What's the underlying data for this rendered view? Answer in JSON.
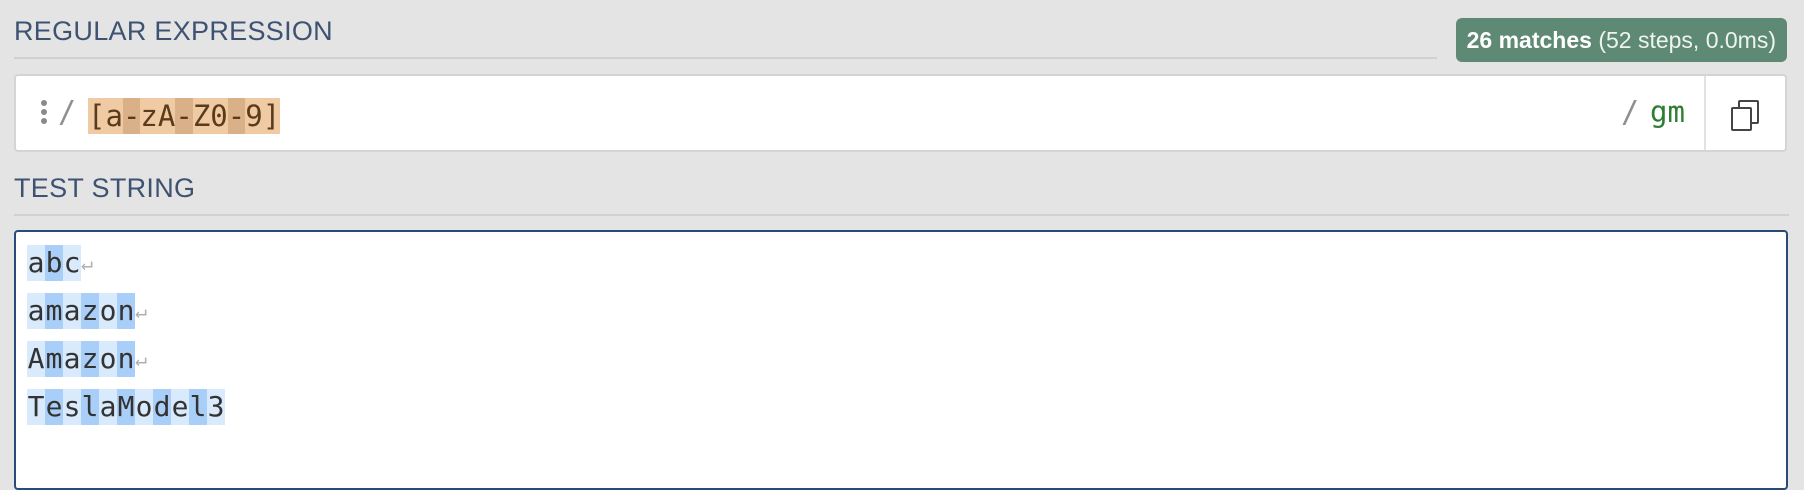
{
  "regex_section": {
    "title": "REGULAR EXPRESSION",
    "match_count": "26 matches",
    "match_detail": "(52 steps, 0.0ms)",
    "open_delimiter": "/",
    "close_delimiter": "/",
    "pattern_tokens": [
      "[",
      "a",
      "-",
      "z",
      "A",
      "-",
      "Z",
      "0",
      "-",
      "9",
      "]"
    ],
    "flags": "gm"
  },
  "test_section": {
    "title": "TEST STRING",
    "lines": [
      "abc",
      "amazon",
      "Amazon",
      "TeslaModel3"
    ],
    "newline_marker": "↵"
  },
  "colors": {
    "title": "#3e5272",
    "badge": "#5e8a75",
    "regex_token": "#f0caa3",
    "regex_range_dash": "#dab089",
    "match_light": "#d9eafd",
    "match_dark": "#a9cff8",
    "flags": "#2e7d32",
    "focus_border": "#2a4a78"
  },
  "icons": {
    "menu": "kebab-menu-icon",
    "copy": "copy-icon"
  }
}
